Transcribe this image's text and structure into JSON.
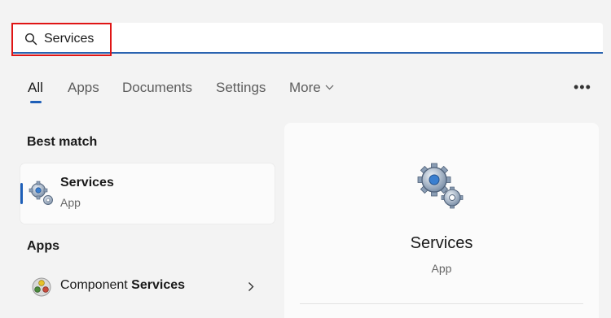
{
  "search": {
    "value": "Services"
  },
  "tabs": [
    {
      "label": "All",
      "active": true
    },
    {
      "label": "Apps"
    },
    {
      "label": "Documents"
    },
    {
      "label": "Settings"
    },
    {
      "label": "More"
    }
  ],
  "overflow_label": "•••",
  "best_match": {
    "heading": "Best match",
    "item": {
      "title": "Services",
      "subtitle": "App",
      "icon": "services-gear-icon"
    }
  },
  "apps": {
    "heading": "Apps",
    "items": [
      {
        "label_prefix": "Component ",
        "label_match": "Services",
        "icon": "component-services-icon"
      }
    ]
  },
  "preview": {
    "title": "Services",
    "subtitle": "App",
    "icon": "services-gear-icon"
  },
  "colors": {
    "accent": "#1e5fb8",
    "highlight_box": "#e01515",
    "background": "#f3f3f3"
  }
}
